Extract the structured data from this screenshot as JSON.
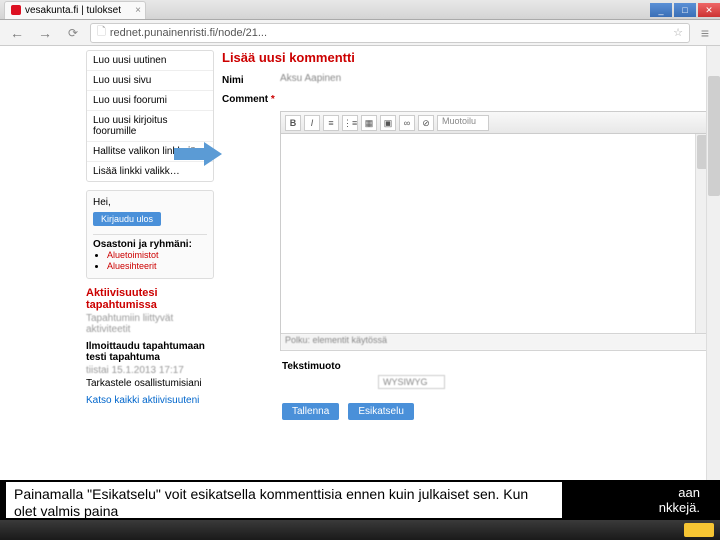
{
  "browser": {
    "tab_title": "vesakunta.fi | tulokset",
    "url": "rednet.punainenristi.fi/node/21...",
    "win_min": "_",
    "win_max": "□",
    "win_close": "✕"
  },
  "sidebar": {
    "items": [
      "Luo uusi uutinen",
      "Luo uusi sivu",
      "Luo uusi foorumi",
      "Luo uusi kirjoitus foorumille",
      "Hallitse valikon linkkejä",
      "Lisää linkki valikk…"
    ]
  },
  "userbox": {
    "greeting": "Hei,",
    "logout": "Kirjaudu ulos",
    "groups_label": "Osastoni ja ryhmäni:",
    "groups": [
      "Aluetoimistot",
      "Aluesihteerit"
    ]
  },
  "activity": {
    "title": "Aktiivisuutesi tapahtumissa",
    "subtitle": "Tapahtumiin liittyvät aktiviteetit",
    "signup": "Ilmoittaudu tapahtumaan testi tapahtuma",
    "date": "tiistai 15.1.2013 17:17",
    "view": "Tarkastele osallistumisiani",
    "all": "Katso kaikki aktiivisuuteni"
  },
  "form": {
    "heading": "Lisää uusi kommentti",
    "name_label": "Nimi",
    "name_value": "Aksu Aapinen",
    "comment_label": "Comment",
    "toolbar_format": "Muotoilu",
    "footer": "Polku: elementit käytössä",
    "format_label": "Tekstimuoto",
    "format_value": "WYSIWYG",
    "save": "Tallenna",
    "preview": "Esikatselu"
  },
  "overlay": {
    "caption": "Painamalla \"Esikatselu\" voit esikatsella kommenttisia ennen kuin julkaiset sen. Kun olet valmis paina",
    "right1": "aan",
    "right2": "nkkejä."
  }
}
